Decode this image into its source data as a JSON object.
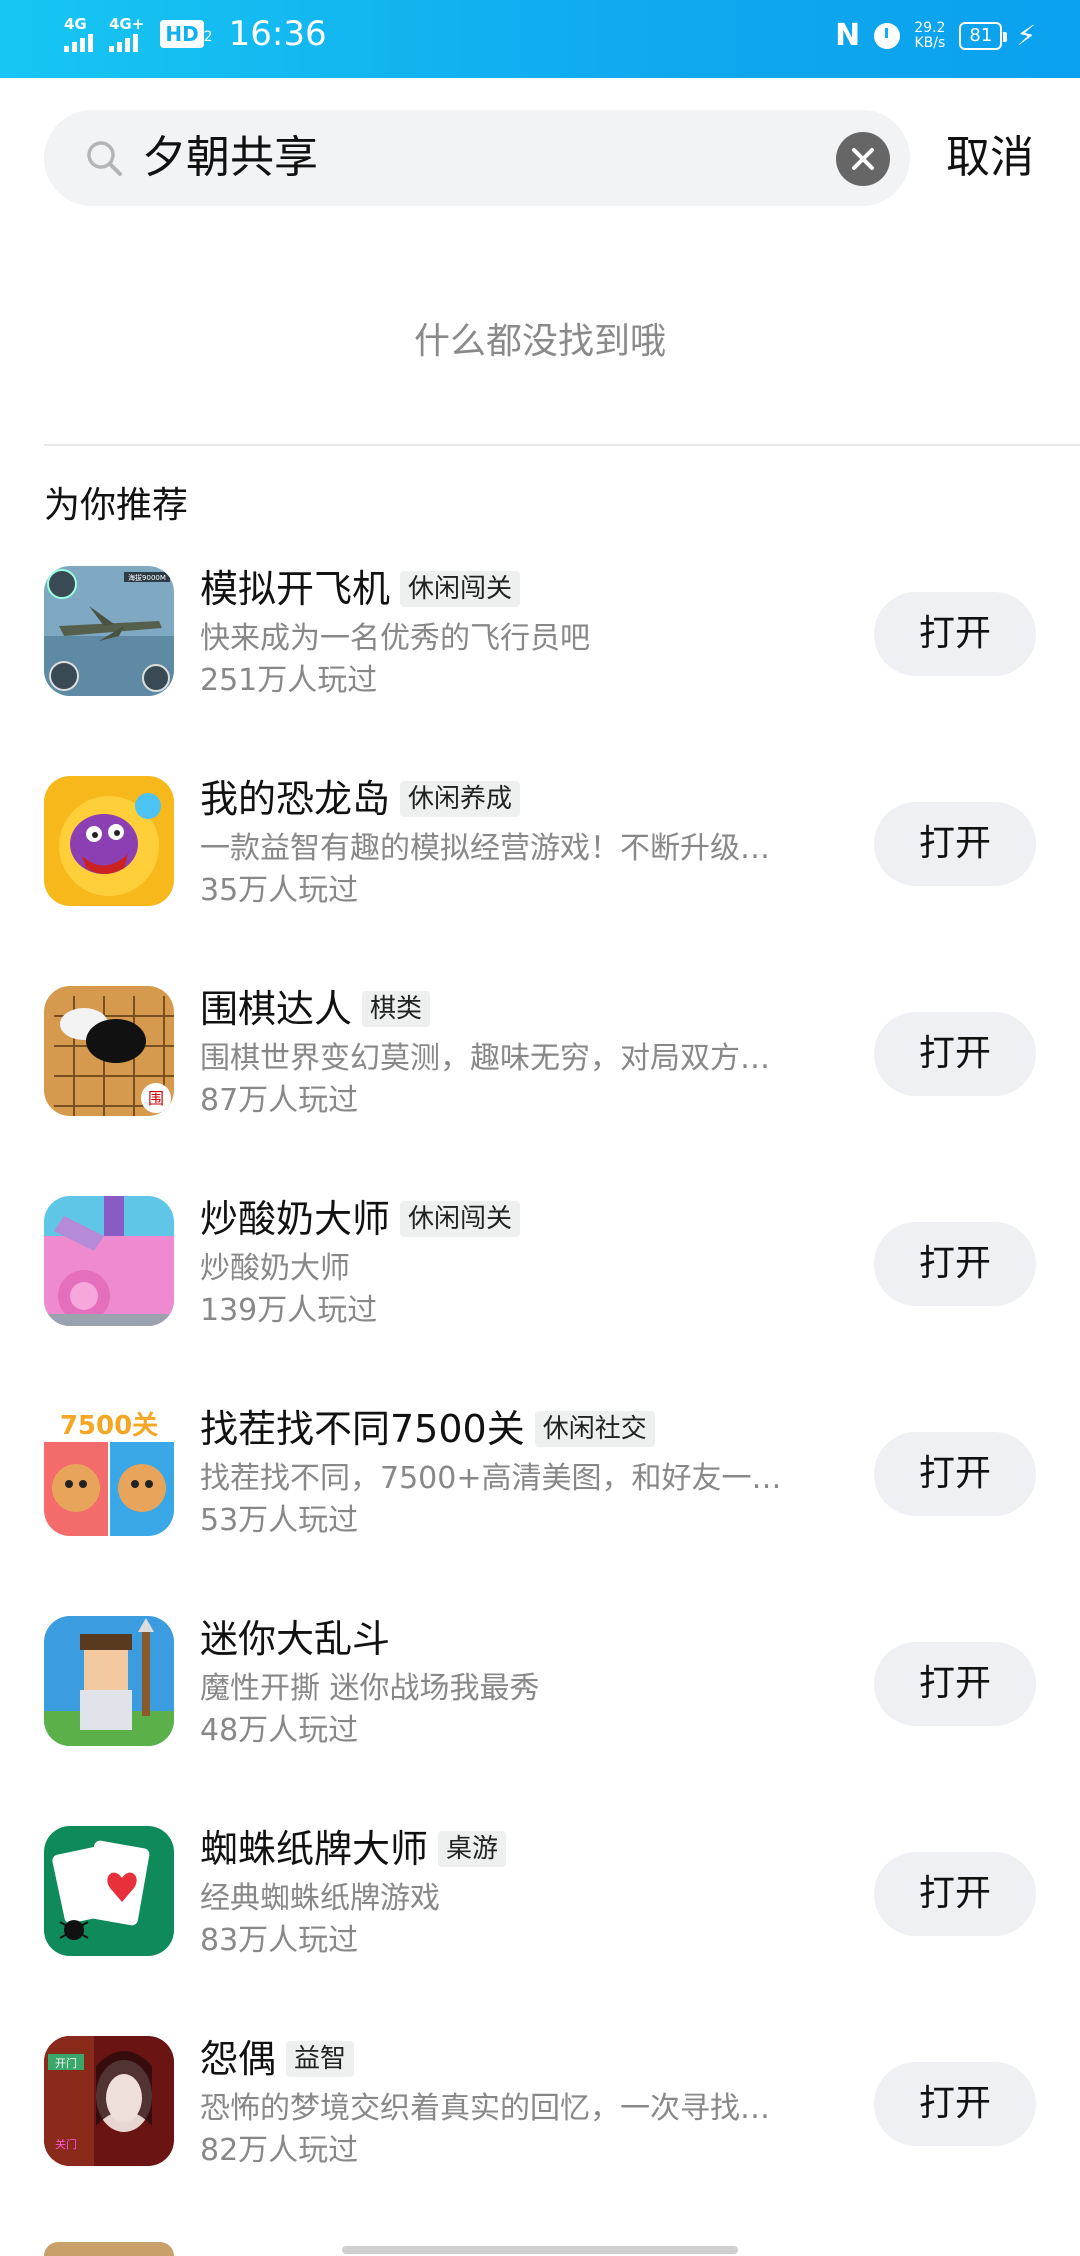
{
  "status_bar": {
    "signal1": "4G",
    "signal2": "4G+",
    "hd": "HD",
    "hd_sub": "2",
    "time": "16:36",
    "nfc": "N",
    "speed_value": "29.2",
    "speed_unit": "KB/s",
    "battery": "81"
  },
  "search": {
    "query": "夕朝共享",
    "cancel_label": "取消"
  },
  "empty_message": "什么都没找到哦",
  "section_title": "为你推荐",
  "open_label": "打开",
  "apps": [
    {
      "name": "模拟开飞机",
      "tag": "休闲闯关",
      "desc": "快来成为一名优秀的飞行员吧",
      "plays": "251万人玩过"
    },
    {
      "name": "我的恐龙岛",
      "tag": "休闲养成",
      "desc": "一款益智有趣的模拟经营游戏！不断升级…",
      "plays": "35万人玩过"
    },
    {
      "name": "围棋达人",
      "tag": "棋类",
      "desc": "围棋世界变幻莫测，趣味无穷，对局双方…",
      "plays": "87万人玩过"
    },
    {
      "name": "炒酸奶大师",
      "tag": "休闲闯关",
      "desc": "炒酸奶大师",
      "plays": "139万人玩过"
    },
    {
      "name": "找茬找不同7500关",
      "tag": "休闲社交",
      "desc": "找茬找不同，7500+高清美图，和好友一…",
      "plays": "53万人玩过"
    },
    {
      "name": "迷你大乱斗",
      "tag": "",
      "desc": "魔性开撕 迷你战场我最秀",
      "plays": "48万人玩过"
    },
    {
      "name": "蜘蛛纸牌大师",
      "tag": "桌游",
      "desc": "经典蜘蛛纸牌游戏",
      "plays": "83万人玩过"
    },
    {
      "name": "怨偶",
      "tag": "益智",
      "desc": "恐怖的梦境交织着真实的回忆，一次寻找…",
      "plays": "82万人玩过"
    }
  ],
  "icon_texts": {
    "plane_badge": "海拔9000M",
    "diff_badge": "7500关",
    "horror_top": "开门",
    "horror_bottom": "关门",
    "go_seal": "围"
  }
}
